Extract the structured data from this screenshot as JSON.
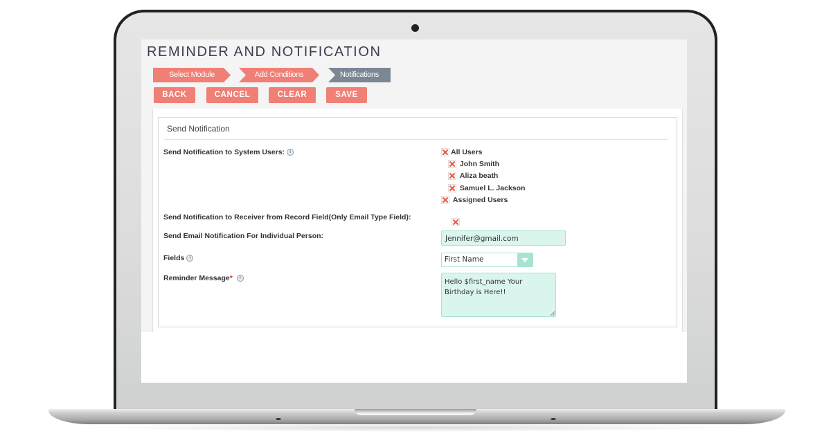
{
  "page": {
    "title": "REMINDER AND NOTIFICATION"
  },
  "wizard": {
    "steps": [
      {
        "label": "Select Module",
        "state": "complete"
      },
      {
        "label": "Add Conditions",
        "state": "complete"
      },
      {
        "label": "Notifications",
        "state": "active"
      }
    ]
  },
  "toolbar": {
    "back_label": "BACK",
    "cancel_label": "CANCEL",
    "clear_label": "CLEAR",
    "save_label": "SAVE"
  },
  "panel": {
    "heading": "Send Notification",
    "system_users": {
      "label": "Send Notification to System Users:",
      "info_icon": "info-icon",
      "all_users_label": "All Users",
      "users": [
        "John Smith",
        "Aliza beath",
        "Samuel L. Jackson"
      ],
      "assigned_users_label": "Assigned Users"
    },
    "record_field": {
      "label": "Send Notification to Receiver from Record Field(Only Email Type Field):"
    },
    "individual": {
      "label": "Send Email Notification For Individual Person:",
      "value": "Jennifer@gmail.com"
    },
    "fields": {
      "label": "Fields",
      "selected": "First Name"
    },
    "message": {
      "label": "Reminder Message",
      "required_mark": "*",
      "value": "Hello $first_name Your Birthday is Here!!"
    }
  },
  "colors": {
    "accent": "#f07f75",
    "active_step": "#7b8795",
    "input_bg": "#daf5ee",
    "input_border": "#a6e3d3",
    "check_mark": "#e8513f"
  }
}
